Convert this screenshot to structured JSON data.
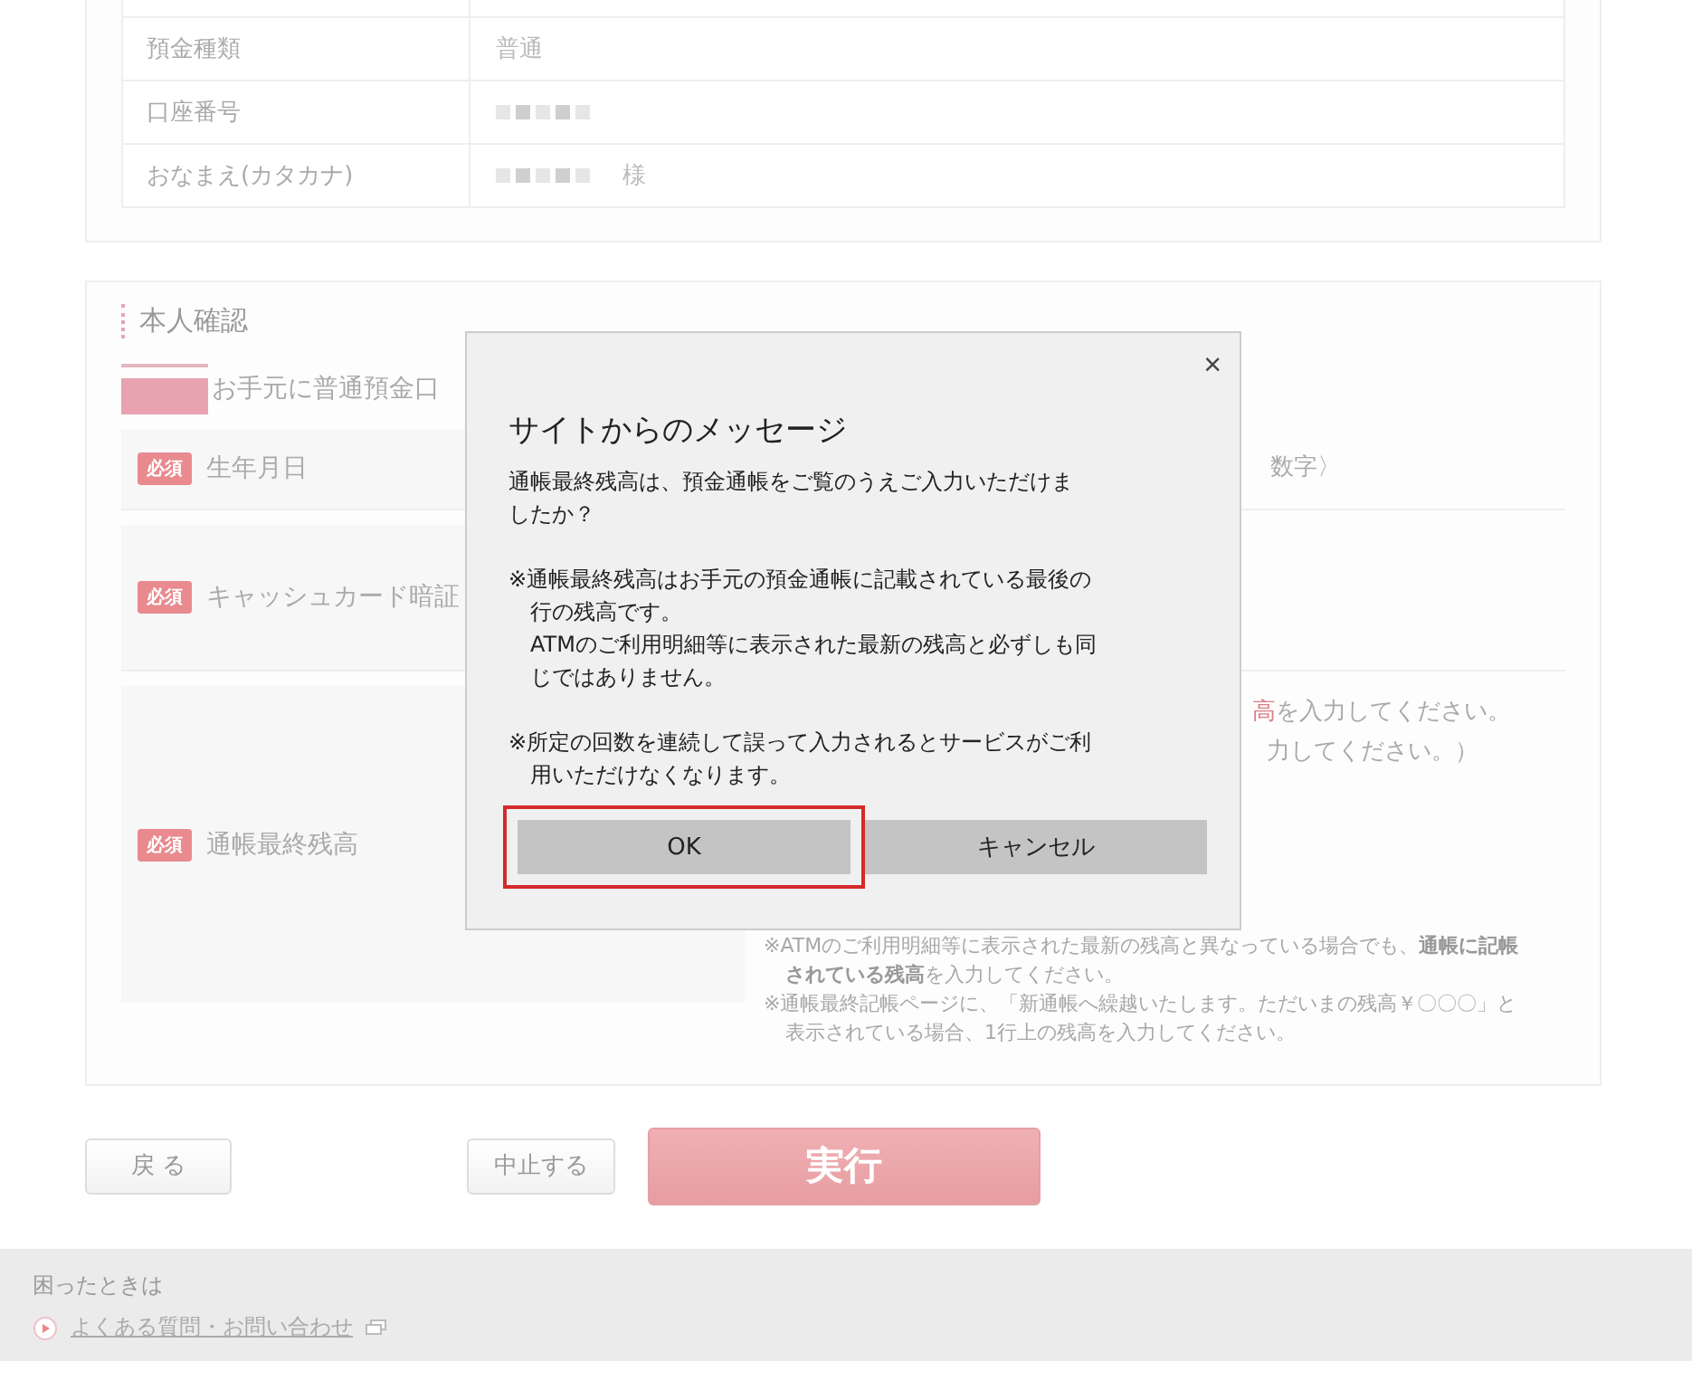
{
  "account_table": {
    "rows": [
      {
        "label": "預金種類",
        "value": "普通",
        "masked": false
      },
      {
        "label": "口座番号",
        "masked": true
      },
      {
        "label": "おなまえ(カタカナ)",
        "masked": true,
        "suffix": "様"
      }
    ]
  },
  "identity_section": {
    "title": "本人確認",
    "intro": "お手元に普通預金口",
    "fields": [
      {
        "label": "生年月日",
        "required_badge": "必須",
        "hints": [
          {
            "kind": "plain",
            "text": "数字〉"
          }
        ]
      },
      {
        "label": "キャッシュカード暗証",
        "required_badge": "必須"
      },
      {
        "label": "通帳最終残高",
        "required_badge": "必須",
        "hints": [
          {
            "kind": "accent",
            "highlight": "高",
            "text": "を入力してください。"
          },
          {
            "kind": "plain",
            "text": "力してください。）"
          }
        ],
        "notes": [
          "※ATMのご利用明細等に表示された最新の残高と異なっている場合でも、**通帳に記帳されている残高**を入力してください。",
          "※通帳最終記帳ページに、「新通帳へ繰越いたします。ただいまの残高￥〇〇〇」と表示されている場合、1行上の残高を入力してください。"
        ]
      }
    ]
  },
  "buttons": {
    "back": "戻 る",
    "cancel": "中止する",
    "execute": "実行"
  },
  "footer": {
    "heading": "困ったときは",
    "link": "よくある質問・お問い合わせ"
  },
  "dialog": {
    "close": "×",
    "title": "サイトからのメッセージ",
    "paragraphs": [
      "通帳最終残高は、預金通帳をご覧のうえご入力いただけましたか？",
      "※通帳最終残高はお手元の預金通帳に記載されている最後の行の残高です。\nATMのご利用明細等に表示された最新の残高と必ずしも同じではありません。",
      "※所定の回数を連続して誤って入力されるとサービスがご利用いただけなくなります。"
    ],
    "buttons": [
      {
        "label": "OK",
        "focused": true
      },
      {
        "label": "キャンセル",
        "focused": false
      }
    ]
  }
}
